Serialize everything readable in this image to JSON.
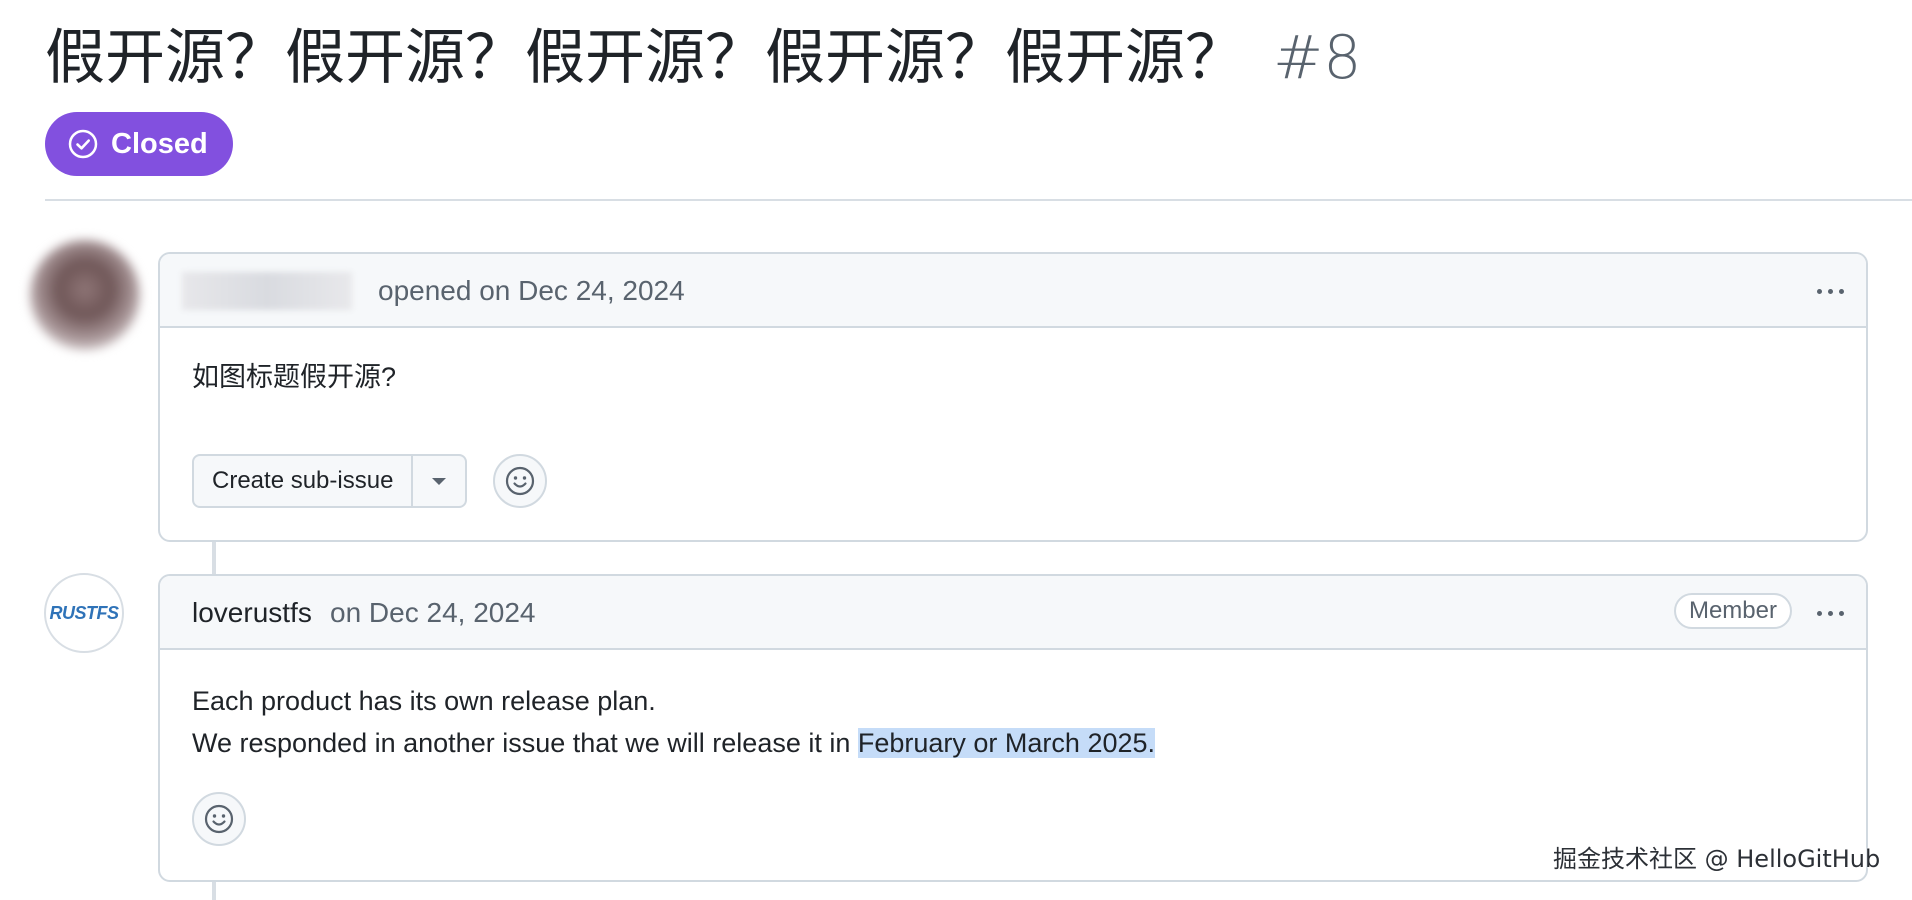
{
  "issue": {
    "title": "假开源？假开源？假开源？假开源？假开源？",
    "number": "#8",
    "state": "Closed",
    "state_color": "#8250df"
  },
  "comments": [
    {
      "author": "",
      "action_text": "opened on Dec 24, 2024",
      "body_lines": [
        "如图标题假开源?"
      ],
      "actions": {
        "create_sub_issue_label": "Create sub-issue"
      }
    },
    {
      "author": "loverustfs",
      "time_text": "on Dec 24, 2024",
      "badge": "Member",
      "avatar_text": "RUSTFS",
      "body_line_1": "Each product has its own release plan.",
      "body_line_2_prefix": "We responded in another issue that we will release it in ",
      "body_line_2_highlight": "February or March 2025."
    }
  ],
  "watermark": "掘金技术社区 @ HelloGitHub",
  "icons": {
    "state": "check-circle-icon",
    "emoji": "smiley-icon",
    "more": "kebab-horizontal-icon",
    "dropdown": "triangle-down-icon"
  }
}
